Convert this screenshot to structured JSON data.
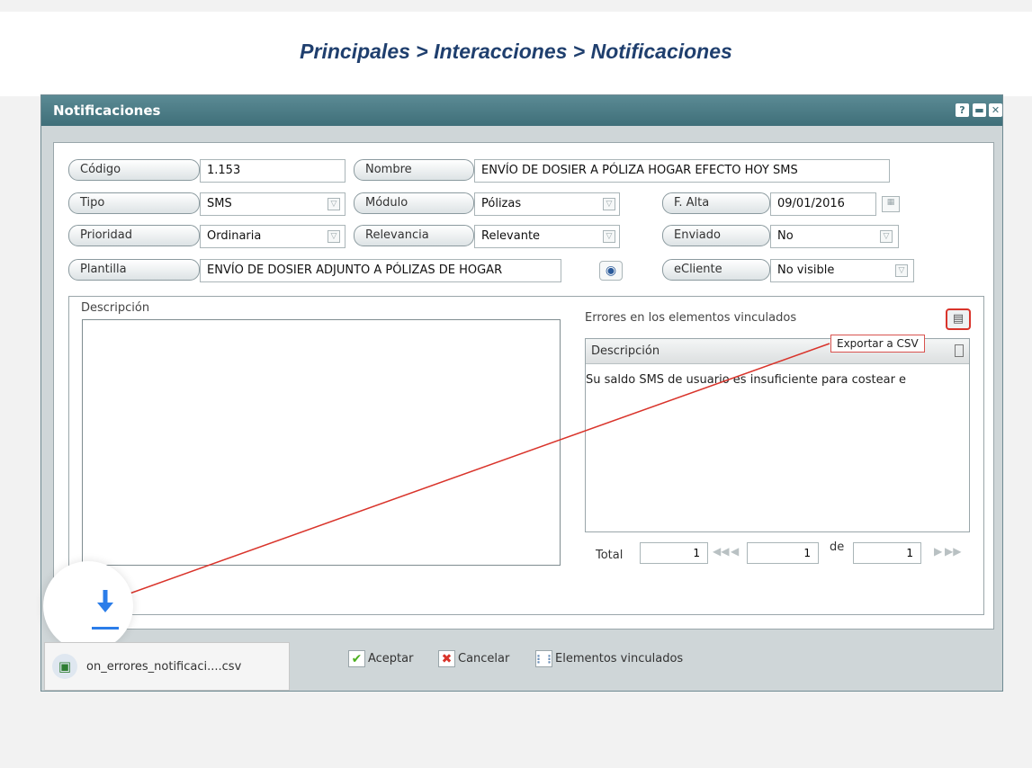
{
  "breadcrumb": "Principales > Interacciones > Notificaciones",
  "window": {
    "title": "Notificaciones",
    "help_icon": "question-icon",
    "minimize_icon": "minimize-icon",
    "close_icon": "close-icon"
  },
  "form": {
    "codigo_label": "Código",
    "codigo_value": "1.153",
    "nombre_label": "Nombre",
    "nombre_value": "ENVÍO DE DOSIER A PÓLIZA HOGAR EFECTO HOY SMS",
    "tipo_label": "Tipo",
    "tipo_value": "SMS",
    "modulo_label": "Módulo",
    "modulo_value": "Pólizas",
    "falta_label": "F. Alta",
    "falta_value": "09/01/2016",
    "prioridad_label": "Prioridad",
    "prioridad_value": "Ordinaria",
    "relevancia_label": "Relevancia",
    "relevancia_value": "Relevante",
    "enviado_label": "Enviado",
    "enviado_value": "No",
    "plantilla_label": "Plantilla",
    "plantilla_value": "ENVÍO DE DOSIER ADJUNTO A PÓLIZAS DE HOGAR",
    "ecliente_label": "eCliente",
    "ecliente_value": "No visible"
  },
  "descripcion": {
    "label": "Descripción",
    "value": ""
  },
  "errores": {
    "title": "Errores en los elementos vinculados",
    "column_header": "Descripción",
    "rows": [
      "Su saldo SMS de usuario es insuficiente para costear e"
    ],
    "export_tooltip": "Exportar a CSV",
    "pager": {
      "total_label": "Total",
      "total_value": "1",
      "page_value": "1",
      "de_label": "de",
      "pages_value": "1"
    }
  },
  "buttons": {
    "aceptar": "Aceptar",
    "cancelar": "Cancelar",
    "elementos": "Elementos vinculados"
  },
  "download": {
    "filename": "on_errores_notificaci....csv",
    "icon": "download-icon",
    "file_icon": "excel-file-icon"
  },
  "colors": {
    "titlebar": "#4a7a84",
    "breadcrumb": "#1f3f6e",
    "annotation": "#d9342b",
    "download_blue": "#2b7de9"
  }
}
